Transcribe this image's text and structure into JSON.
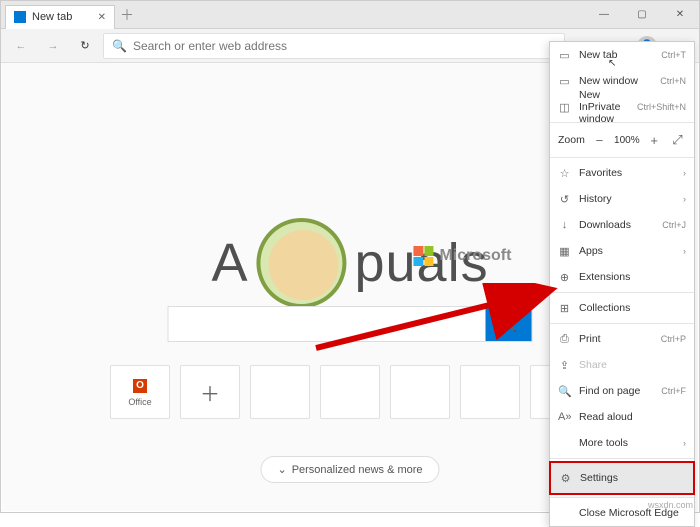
{
  "tab": {
    "title": "New tab"
  },
  "toolbar": {
    "search_placeholder": "Search or enter web address"
  },
  "ntp": {
    "tiles": [
      {
        "label": "Office"
      }
    ],
    "news_button": "Personalized news & more"
  },
  "watermark": {
    "brand": "Microsoft",
    "text_left": "A",
    "text_right": "puals"
  },
  "menu": {
    "new_tab": {
      "label": "New tab",
      "shortcut": "Ctrl+T"
    },
    "new_window": {
      "label": "New window",
      "shortcut": "Ctrl+N"
    },
    "new_inprivate": {
      "label": "New InPrivate window",
      "shortcut": "Ctrl+Shift+N"
    },
    "zoom": {
      "label": "Zoom",
      "value": "100%"
    },
    "favorites": {
      "label": "Favorites"
    },
    "history": {
      "label": "History"
    },
    "downloads": {
      "label": "Downloads",
      "shortcut": "Ctrl+J"
    },
    "apps": {
      "label": "Apps"
    },
    "extensions": {
      "label": "Extensions"
    },
    "collections": {
      "label": "Collections"
    },
    "print": {
      "label": "Print",
      "shortcut": "Ctrl+P"
    },
    "share": {
      "label": "Share"
    },
    "find": {
      "label": "Find on page",
      "shortcut": "Ctrl+F"
    },
    "read_aloud": {
      "label": "Read aloud"
    },
    "more_tools": {
      "label": "More tools"
    },
    "settings": {
      "label": "Settings"
    },
    "close": {
      "label": "Close Microsoft Edge"
    }
  },
  "credit": "wsxdn.com"
}
